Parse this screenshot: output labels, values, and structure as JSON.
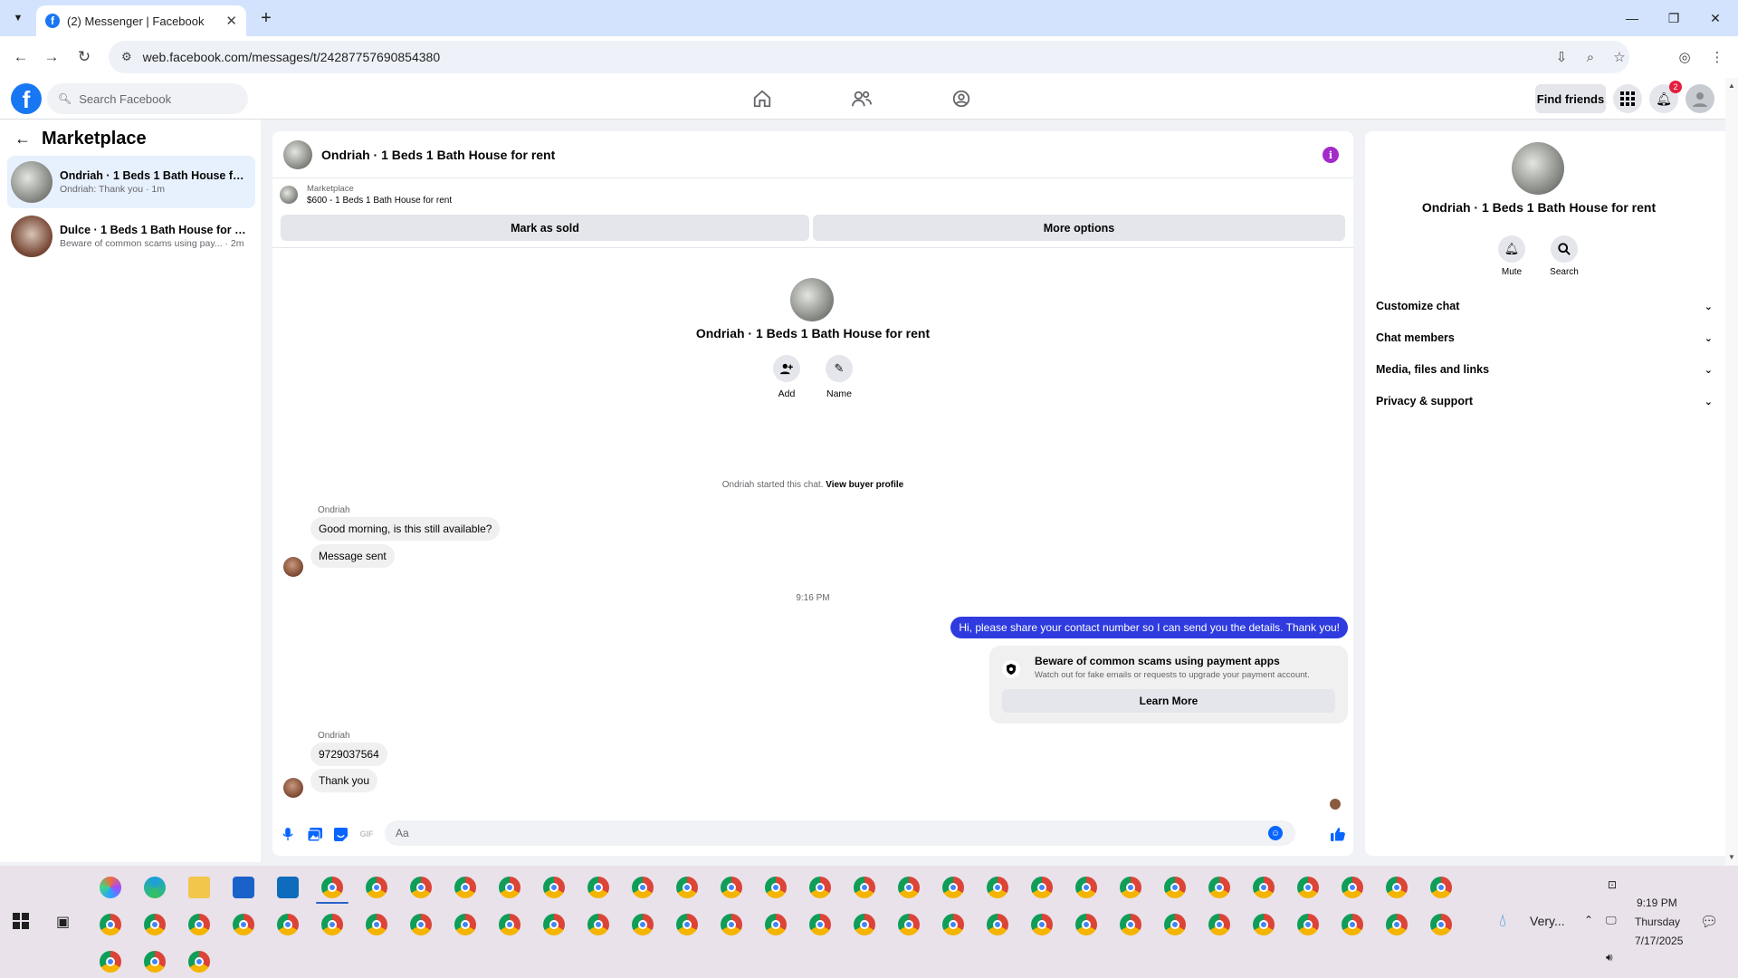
{
  "browser": {
    "tab_title": "(2) Messenger | Facebook",
    "url": "web.facebook.com/messages/t/24287757690854380"
  },
  "fb": {
    "search_placeholder": "Search Facebook",
    "find_friends": "Find friends",
    "notification_count": "2"
  },
  "sidebar": {
    "title": "Marketplace",
    "conversations": [
      {
        "name": "Ondriah · 1 Beds 1 Bath House for r...",
        "preview": "Ondriah: Thank you · 1m"
      },
      {
        "name": "Dulce · 1 Beds 1 Bath House for rent",
        "preview": "Beware of common scams using pay... · 2m"
      }
    ]
  },
  "chat": {
    "title": "Ondriah · 1 Beds 1 Bath House for rent",
    "listing_source": "Marketplace",
    "listing_detail": "$600 - 1 Beds 1 Bath House for rent",
    "mark_sold": "Mark as sold",
    "more_options": "More options",
    "intro_name": "Ondriah · 1 Beds 1 Bath House for rent",
    "add_label": "Add",
    "name_label": "Name",
    "system_text": "Ondriah started this chat.",
    "system_link": "View buyer profile",
    "sender_1": "Ondriah",
    "msg_1": "Good morning, is this still available?",
    "msg_2": "Message sent",
    "timestamp": "9:16 PM",
    "outgoing": "Hi, please share your contact number so I can send you the details. Thank you!",
    "scam_title": "Beware of common scams using payment apps",
    "scam_sub": "Watch out for fake emails or requests to upgrade your payment account.",
    "learn_more": "Learn More",
    "sender_2": "Ondriah",
    "msg_3": "9729037564",
    "msg_4": "Thank you",
    "composer_placeholder": "Aa"
  },
  "right_panel": {
    "name": "Ondriah · 1 Beds 1 Bath House for rent",
    "mute": "Mute",
    "search": "Search",
    "sections": [
      "Customize chat",
      "Chat members",
      "Media, files and links",
      "Privacy & support"
    ]
  },
  "taskbar": {
    "weather": "Very...",
    "time": "9:19 PM",
    "day": "Thursday",
    "date": "7/17/2025"
  },
  "colors": {
    "brand": "#1877f2",
    "outgoing_bubble": "#2f3bde",
    "info": "#a22bc9"
  }
}
